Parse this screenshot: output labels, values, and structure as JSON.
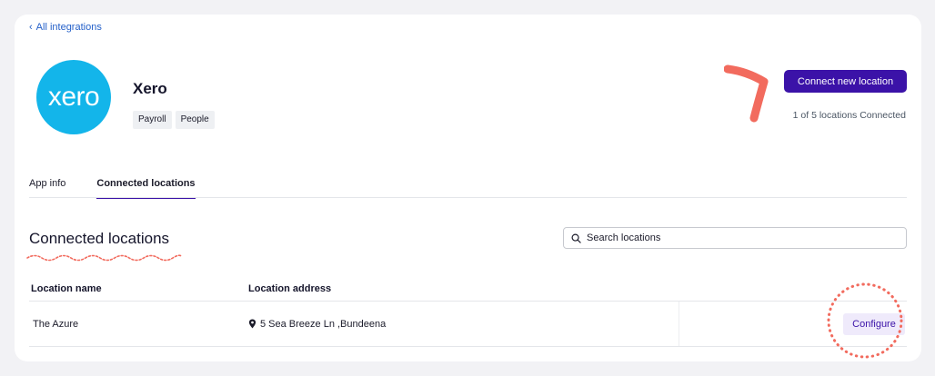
{
  "nav": {
    "back_label": "All integrations"
  },
  "app": {
    "logo_text": "xero",
    "name": "Xero",
    "tags": [
      "Payroll",
      "People"
    ]
  },
  "header": {
    "connect_label": "Connect new location",
    "connected_count": "1 of 5 locations Connected"
  },
  "tabs": [
    {
      "label": "App info",
      "active": false
    },
    {
      "label": "Connected locations",
      "active": true
    }
  ],
  "section": {
    "title": "Connected locations",
    "search_placeholder": "Search locations"
  },
  "table": {
    "headers": [
      "Location name",
      "Location address"
    ],
    "rows": [
      {
        "name": "The Azure",
        "address": "5 Sea Breeze Ln ,Bundeena",
        "action": "Configure"
      }
    ]
  },
  "colors": {
    "accent": "#3b12a8",
    "logo_bg": "#13b5ea",
    "link": "#2460c9",
    "annotation": "#f26b5e"
  },
  "icons": {
    "back": "chevron-left-icon",
    "search": "search-icon",
    "location": "location-pin-icon"
  }
}
